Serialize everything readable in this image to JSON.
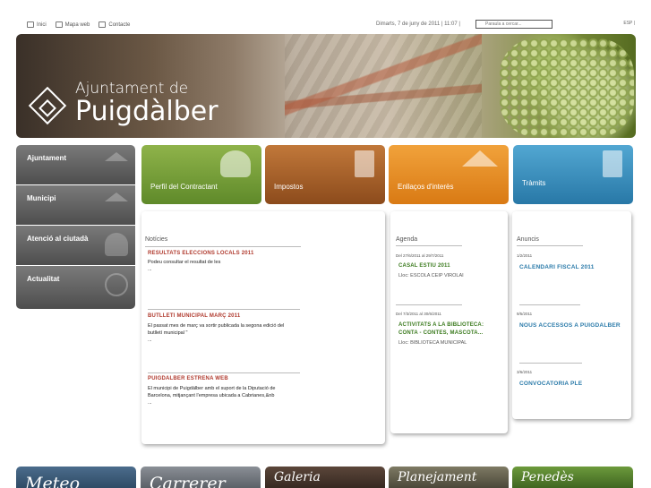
{
  "topbar": {
    "nav": [
      {
        "label": "Inici",
        "icon": "home-icon"
      },
      {
        "label": "Mapa web",
        "icon": "sitemap-icon"
      },
      {
        "label": "Contacte",
        "icon": "mail-icon"
      }
    ],
    "date": "Dimarts, 7 de juny de 2011 | 11:07 |",
    "search_placeholder": "Paraula a cercar...",
    "language": "ESP |"
  },
  "banner": {
    "line1": "Ajuntament de",
    "line2": "Puigdàlber"
  },
  "left_menu": [
    {
      "label": "Ajuntament",
      "icon": "house-icon"
    },
    {
      "label": "Municipi",
      "icon": "houses-icon"
    },
    {
      "label": "Atenció al ciutadà",
      "icon": "people-icon"
    },
    {
      "label": "Actualitat",
      "icon": "globe-icon"
    }
  ],
  "tiles": [
    {
      "label": "Perfil del Contractant",
      "icon": "people-icon",
      "color": "#7aa23d"
    },
    {
      "label": "Impostos",
      "icon": "document-icon",
      "color": "#a9622b"
    },
    {
      "label": "Enllaços d'interès",
      "icon": "house-icon",
      "color": "#ee9a2c"
    },
    {
      "label": "Tràmits",
      "icon": "document-icon",
      "color": "#3d95c6"
    }
  ],
  "news": {
    "title": "Notícies",
    "items": [
      {
        "title": "RESULTATS ELECCIONS LOCALS 2011",
        "line1": "Podeu consultar el resultat de les",
        "line2": "...",
        "line3": ""
      },
      {
        "title": "BUTLLETI MUNICIPAL MARÇ 2011",
        "line1": "El passat mes de març va sortir publicada la segona edició del",
        "line2": "butlletí municipal \"",
        "line3": "..."
      },
      {
        "title": "PUIGDALBER ESTRENA WEB",
        "line1": "El municipi de Puigdàlber amb el suport de la Diputació de",
        "line2": "Barcelona, mitjançant l'empresa ubicada a Cabrianes,&nb",
        "line3": "..."
      }
    ]
  },
  "agenda": {
    "title": "Agenda",
    "items": [
      {
        "date": "Del 27/6/2011 al 29/7/2011",
        "title1": "CASAL ESTIU 2011",
        "title2": "",
        "place": "Lloc: ESCOLA CEIP VIROLAI"
      },
      {
        "date": "Del 7/3/2011 al 30/6/2011",
        "title1": "ACTIVITATS A LA BIBLIOTECA:",
        "title2": "CONTA - CONTES, MASCOTA...",
        "place": "Lloc: BIBLIOTECA MUNICIPAL"
      }
    ]
  },
  "anuncis": {
    "title": "Anuncis",
    "items": [
      {
        "date": "1/2/2011",
        "title": "CALENDARI FISCAL 2011"
      },
      {
        "date": "9/5/2011",
        "title": "NOUS ACCESSOS A PUIGDALBER"
      },
      {
        "date": "3/6/2011",
        "title": "CONVOCATORIA PLE"
      }
    ]
  },
  "bottom": [
    {
      "label": "Meteo"
    },
    {
      "label": "Carrerer"
    },
    {
      "label": "Galeria"
    },
    {
      "label": "Planejament"
    },
    {
      "label": "Penedès"
    }
  ]
}
